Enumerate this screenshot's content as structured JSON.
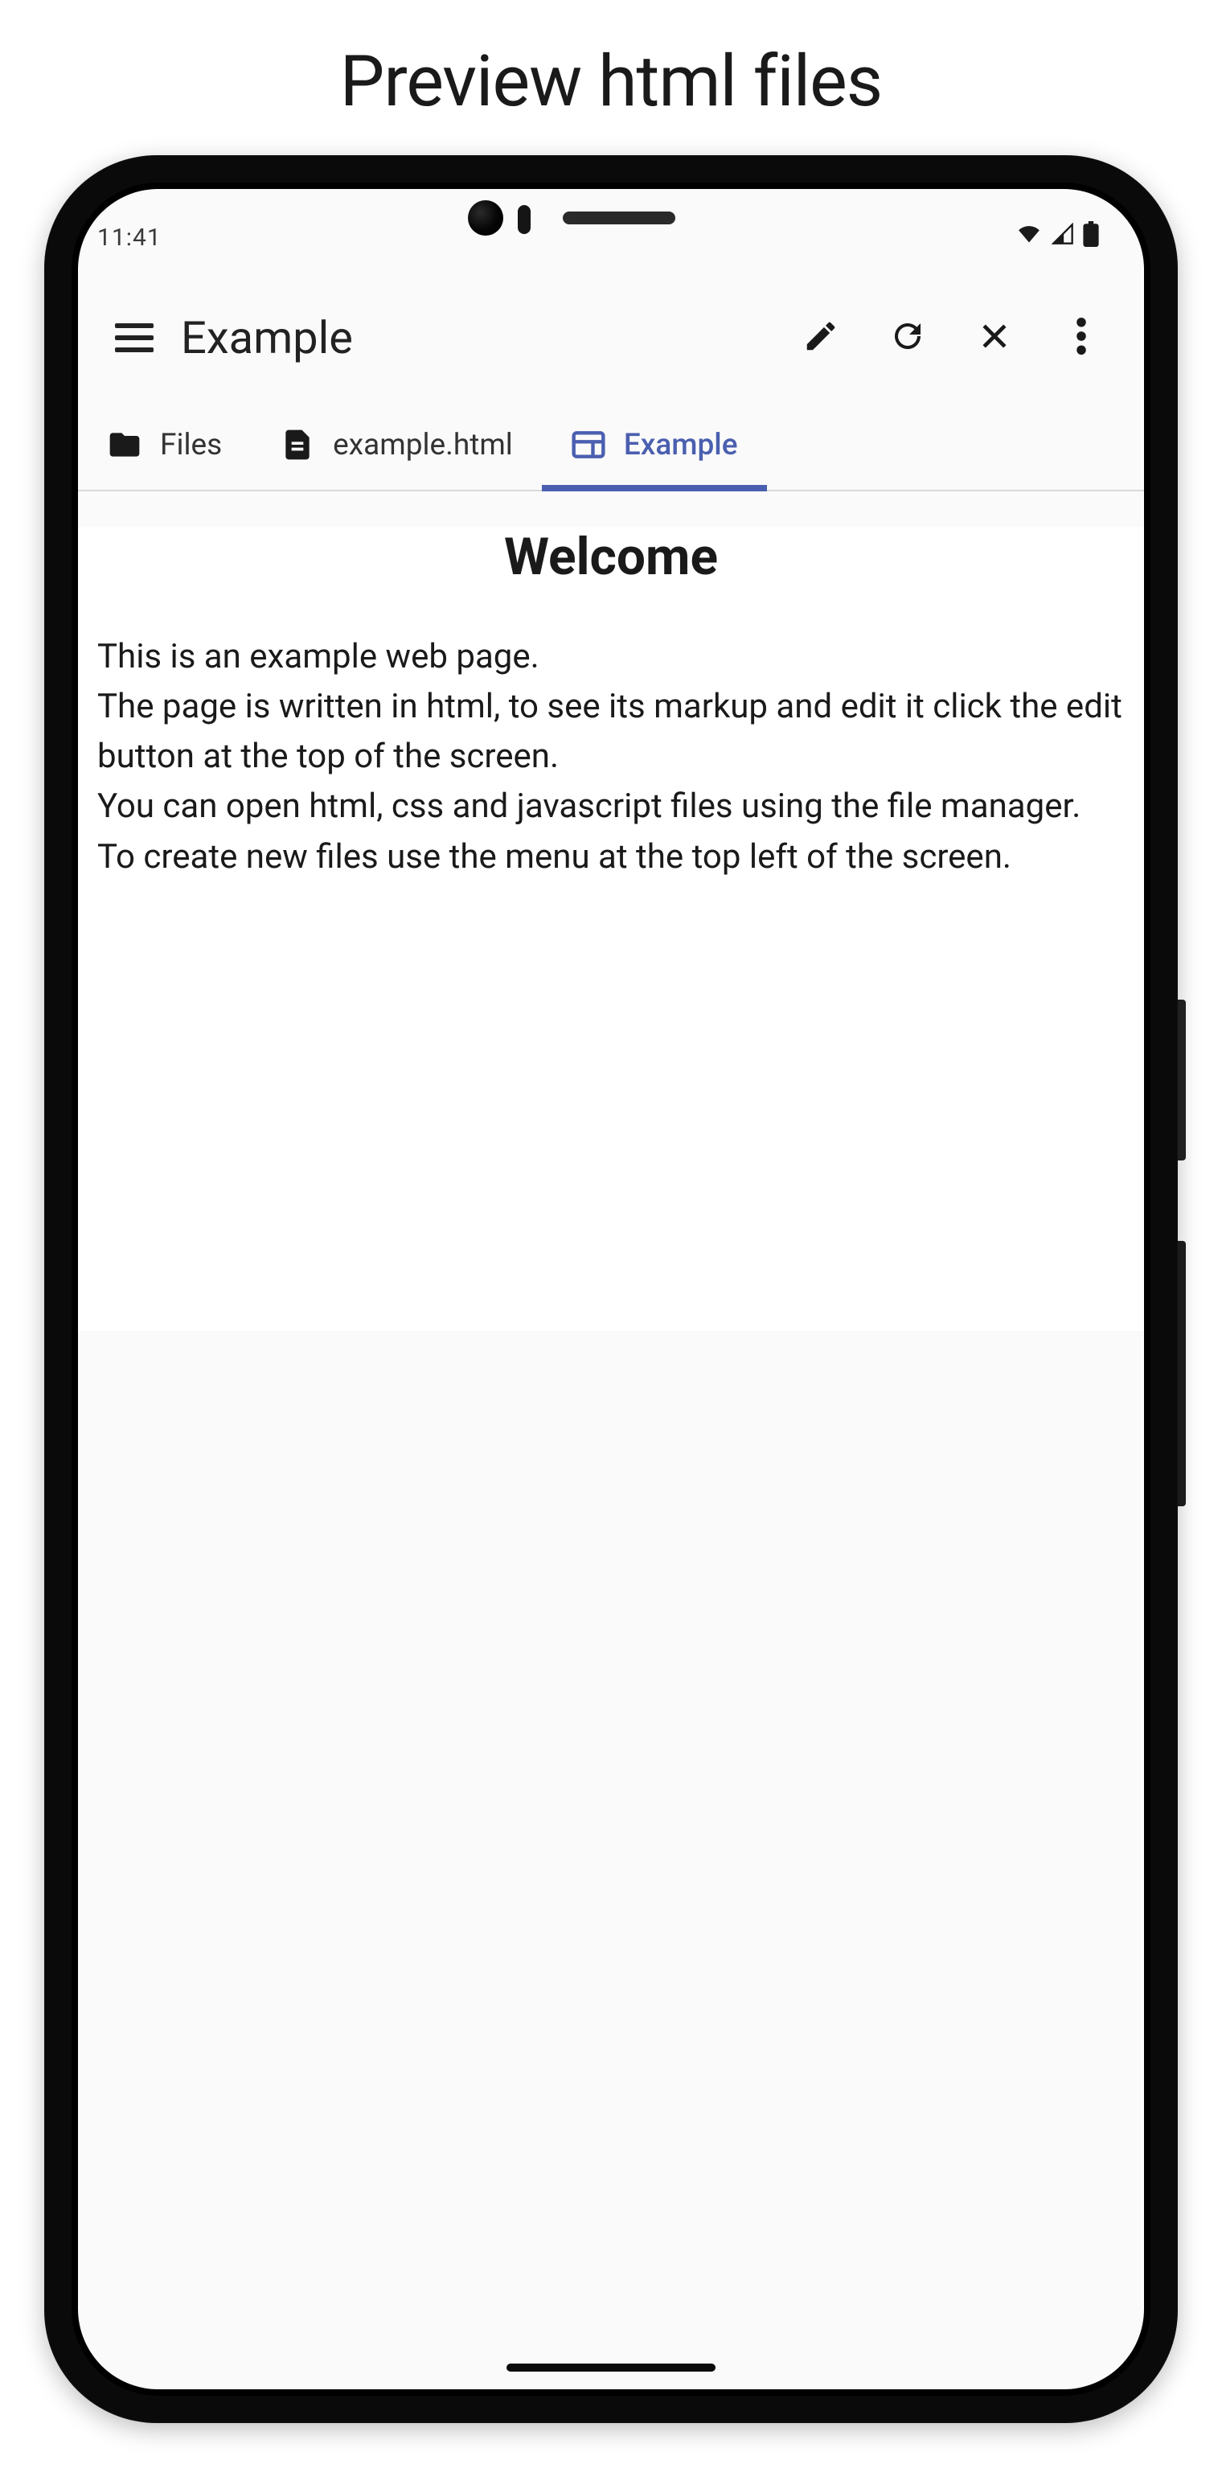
{
  "promoTitle": "Preview html files",
  "statusbar": {
    "time": "11:41"
  },
  "appbar": {
    "title": "Example",
    "actions": {
      "edit": "Edit",
      "refresh": "Refresh",
      "close": "Close",
      "more": "More"
    }
  },
  "tabs": [
    {
      "icon": "folder-icon",
      "label": "Files",
      "active": false
    },
    {
      "icon": "file-icon",
      "label": "example.html",
      "active": false
    },
    {
      "icon": "web-icon",
      "label": "Example",
      "active": true
    }
  ],
  "content": {
    "heading": "Welcome",
    "body": "This is an example web page.\nThe page is written in html, to see its markup and edit it click the edit button at the top of the screen.\nYou can open html, css and javascript files using the file manager.\nTo create new files use the menu at the top left of the screen."
  }
}
